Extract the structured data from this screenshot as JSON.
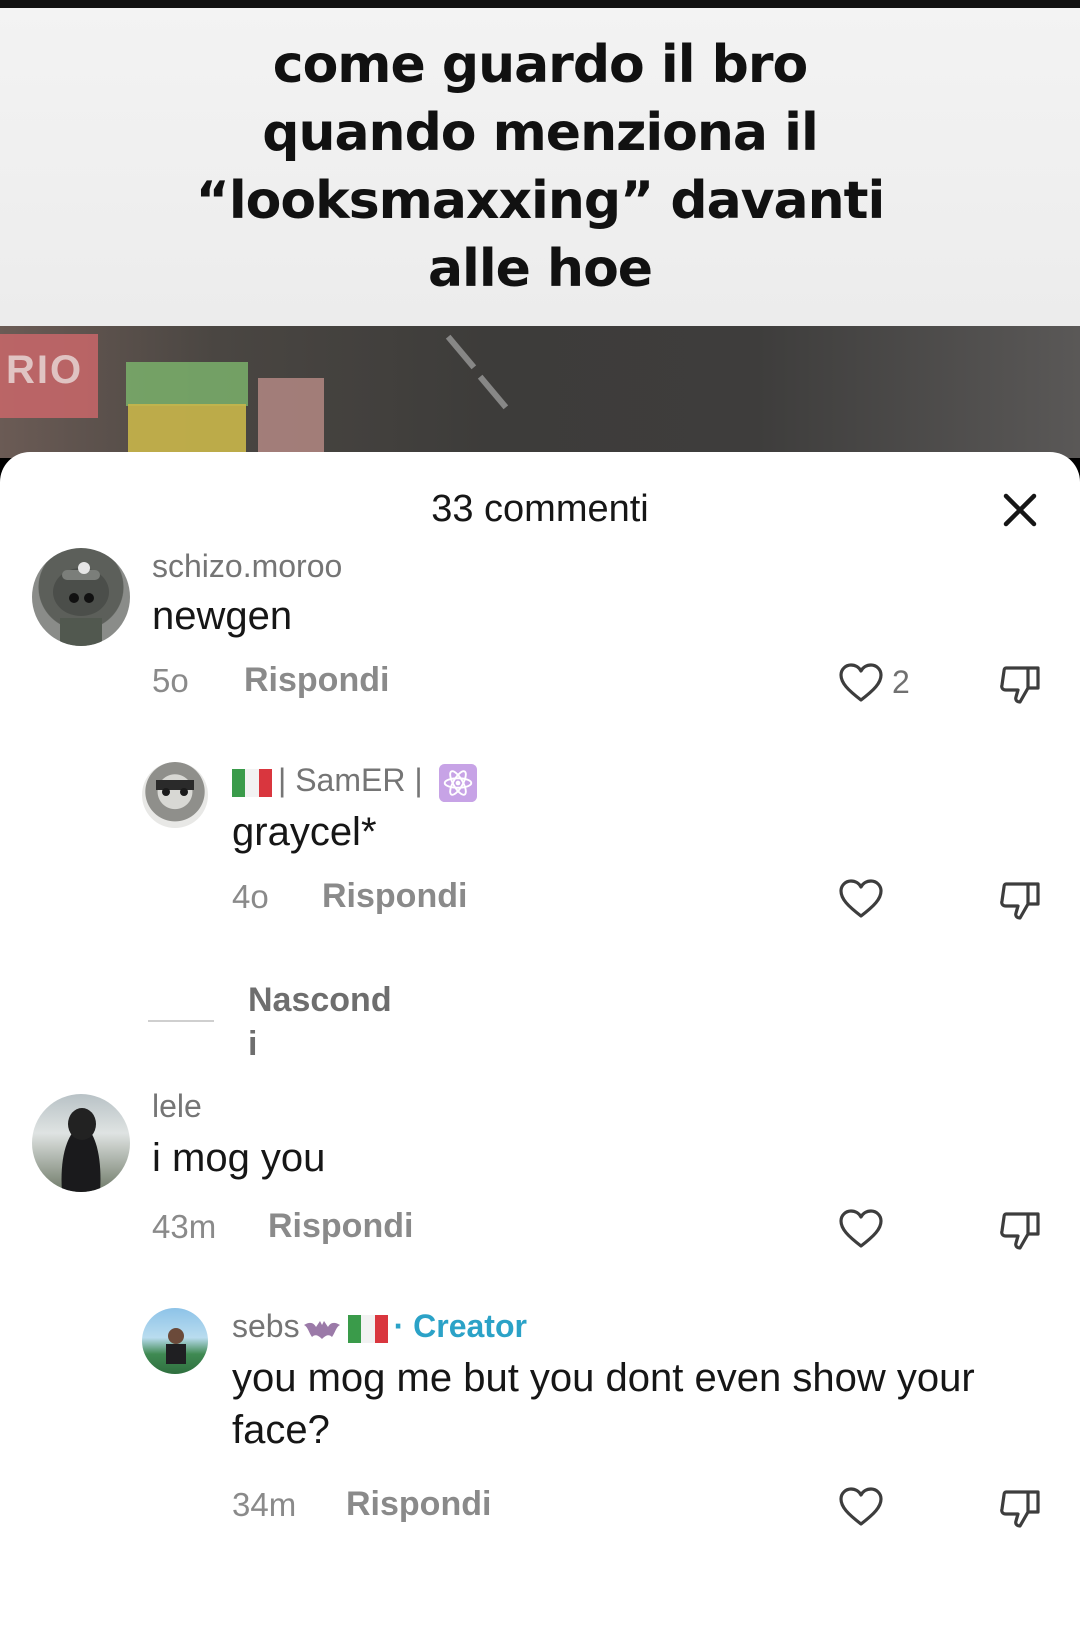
{
  "video": {
    "caption": "come guardo il bro quando menziona il “looksmaxxing” davanti alle hoe",
    "sign_text": "RIO"
  },
  "sheet": {
    "title": "33 commenti",
    "close_icon": "close-icon"
  },
  "comments": [
    {
      "username": "schizo.moroo",
      "text": "newgen",
      "time": "5o",
      "reply_label": "Rispondi",
      "likes": "2"
    },
    {
      "username_prefix": "| SamER |",
      "text": "graycel*",
      "time": "4o",
      "reply_label": "Rispondi"
    },
    {
      "username": "lele",
      "text": "i mog you",
      "time": "43m",
      "reply_label": "Rispondi"
    },
    {
      "username": "sebs",
      "creator_label": "· Creator",
      "text": "you mog me but you dont even show your face?",
      "time": "34m",
      "reply_label": "Rispondi"
    }
  ],
  "hide_replies": {
    "label": "Nascond\ni"
  },
  "colors": {
    "creator": "#2ba2c7",
    "meta": "#8a8a8a",
    "text": "#161616"
  }
}
